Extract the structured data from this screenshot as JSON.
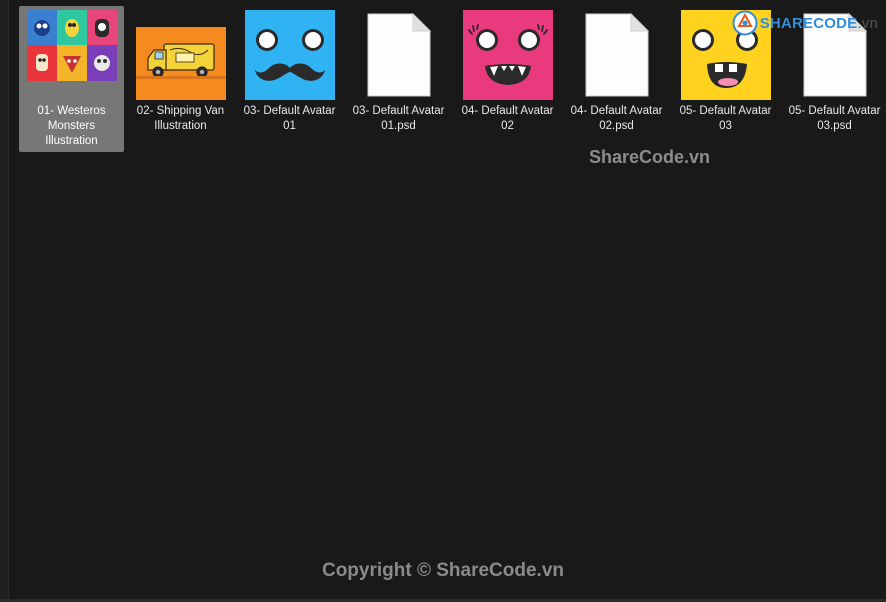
{
  "files": [
    {
      "name": "01- Westeros Monsters Illustration",
      "type": "image",
      "thumbnail": "westeros-monsters-grid",
      "selected": true
    },
    {
      "name": "02- Shipping Van Illustration",
      "type": "image",
      "thumbnail": "shipping-van",
      "selected": false
    },
    {
      "name": "03- Default Avatar 01",
      "type": "image",
      "thumbnail": "avatar-blue-mustache",
      "selected": false
    },
    {
      "name": "03- Default Avatar 01.psd",
      "type": "psd",
      "thumbnail": "blank-document",
      "selected": false
    },
    {
      "name": "04- Default Avatar 02",
      "type": "image",
      "thumbnail": "avatar-pink-fangs",
      "selected": false
    },
    {
      "name": "04- Default Avatar 02.psd",
      "type": "psd",
      "thumbnail": "blank-document",
      "selected": false
    },
    {
      "name": "05- Default Avatar 03",
      "type": "image",
      "thumbnail": "avatar-yellow-smile",
      "selected": false
    },
    {
      "name": "05- Default Avatar 03.psd",
      "type": "psd",
      "thumbnail": "blank-document",
      "selected": false
    }
  ],
  "watermarks": {
    "logo": "SHARECODE.vn",
    "logo_main": "SHARECODE",
    "logo_suffix": ".vn",
    "middle": "ShareCode.vn",
    "copyright": "Copyright © ShareCode.vn"
  },
  "colors": {
    "background": "#191919",
    "selection": "#777777",
    "label_text": "#e8e8e8",
    "avatar_blue": "#2fb3f2",
    "avatar_pink": "#e83a7d",
    "avatar_yellow": "#ffd21f",
    "van_orange": "#f58a1f"
  }
}
